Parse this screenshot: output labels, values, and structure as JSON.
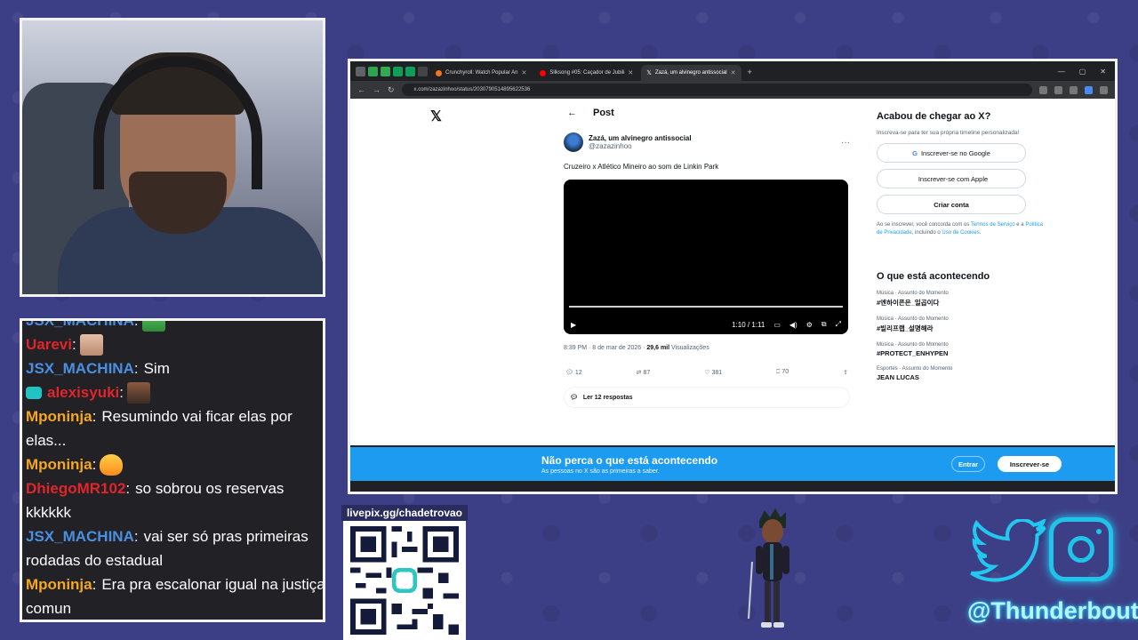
{
  "chat": {
    "lines": [
      {
        "user": "JSX_MACHINA",
        "msg": "",
        "color": "#4a90e2",
        "emote": "frog"
      },
      {
        "user": "Uarevi",
        "msg": "",
        "color": "#e0252b",
        "emote": "face1"
      },
      {
        "user": "JSX_MACHINA",
        "msg": "Sim",
        "color": "#4a90e2",
        "emote": ""
      },
      {
        "user": "alexisyuki",
        "msg": "",
        "color": "#e0252b",
        "emote": "face2"
      },
      {
        "user": "Mponinja",
        "msg": "Resumindo vai ficar elas por",
        "color": "#f5a623",
        "emote": ""
      },
      {
        "user": "",
        "msg": "elas...",
        "color": "#ffffff",
        "emote": ""
      },
      {
        "user": "Mponinja",
        "msg": "",
        "color": "#f5a623",
        "emote": "fire"
      },
      {
        "user": "DhiegoMR102",
        "msg": "so sobrou os reservas",
        "color": "#e0252b",
        "emote": ""
      },
      {
        "user": "",
        "msg": "kkkkkk",
        "color": "#ffffff",
        "emote": ""
      },
      {
        "user": "JSX_MACHINA",
        "msg": "vai ser só pras primeiras",
        "color": "#4a90e2",
        "emote": ""
      },
      {
        "user": "",
        "msg": "rodadas do estadual",
        "color": "#ffffff",
        "emote": ""
      },
      {
        "user": "Mponinja",
        "msg": "Era pra escalonar igual na justiça",
        "color": "#f5a623",
        "emote": ""
      },
      {
        "user": "",
        "msg": "comun",
        "color": "#ffffff",
        "emote": ""
      }
    ]
  },
  "browser": {
    "tabs": [
      {
        "label": "Crunchyroll: Watch Popular An",
        "color": "#f47521"
      },
      {
        "label": "Silksong #05: Caçador de Jubili",
        "color": "#ff0000"
      },
      {
        "label": "Zazá, um alvinegro antissocial",
        "color": "#000000"
      }
    ],
    "url": "x.com/zazazinhoo/status/2030790514895622536",
    "x_logo": "𝕏",
    "post_title": "Post",
    "author_name": "Zazá, um alvinegro antissocial",
    "author_handle": "@zazazinhoo",
    "tweet_text": "Cruzeiro x Atlético Mineiro ao som de Linkin Park",
    "video_time": "1:10 / 1:11",
    "meta_time": "8:39 PM · 8 de mar de 2026 · ",
    "meta_views": "29,6 mil",
    "meta_views_label": " Visualizações",
    "counts": {
      "replies": "12",
      "retweets": "87",
      "likes": "381",
      "bookmarks": "70"
    },
    "read_replies": "Ler 12 respostas",
    "side": {
      "heading": "Acabou de chegar ao X?",
      "sub": "Inscreva-se para ter sua própria timeline personalizada!",
      "google": "Inscrever-se no Google",
      "apple": "Inscrever-se com Apple",
      "create": "Criar conta",
      "legal_1": "Ao se inscrever, você concorda com os ",
      "legal_terms": "Termos de Serviço",
      "legal_2": " e a ",
      "legal_privacy": "Política de Privacidade",
      "legal_3": ", incluindo o ",
      "legal_cookies": "Uso de Cookies",
      "legal_4": ".",
      "trend_heading": "O que está acontecendo",
      "trends": [
        {
          "cat": "Música · Assunto do Momento",
          "name": "#엔하이픈은_일곱이다"
        },
        {
          "cat": "Música · Assunto do Momento",
          "name": "#빌리프랩_설명해라"
        },
        {
          "cat": "Música · Assunto do Momento",
          "name": "#PROTECT_ENHYPEN"
        },
        {
          "cat": "Esportes · Assunto do Momento",
          "name": "JEAN LUCAS"
        }
      ]
    },
    "banner": {
      "title": "Não perca o que está acontecendo",
      "sub": "As pessoas no X são as primeiras a saber.",
      "login": "Entrar",
      "signup": "Inscrever-se"
    }
  },
  "livepix": {
    "label": "livepix.gg/chadetrovao"
  },
  "social": {
    "handle": "@Thunderbout"
  }
}
